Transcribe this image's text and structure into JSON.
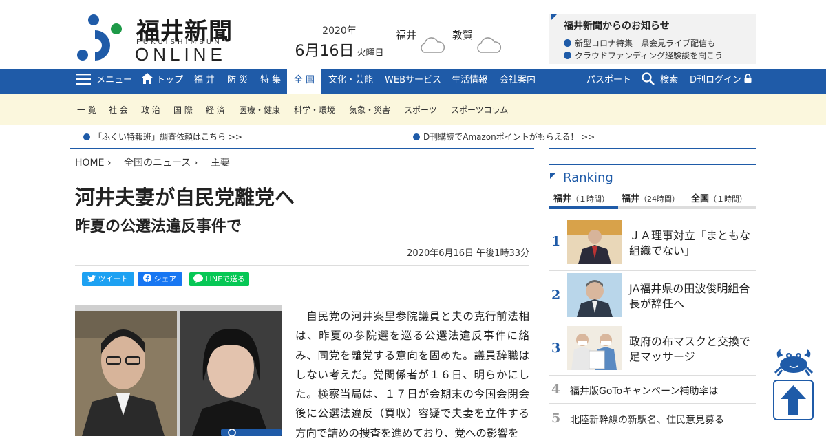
{
  "header": {
    "logo_title": "福井新聞",
    "logo_sub": "FUKUISHIMBUN",
    "logo_online": "ONLINE",
    "date": {
      "year": "2020年",
      "month_day": "6月16日",
      "weekday": "火曜日"
    },
    "weather": [
      {
        "city": "福井",
        "icon": "cloud-icon"
      },
      {
        "city": "敦賀",
        "icon": "cloud-icon"
      }
    ],
    "notice": {
      "title": "福井新聞からのお知らせ",
      "items": [
        "新型コロナ特集　県会見ライブ配信も",
        "クラウドファンディング経験談を聞こう"
      ]
    }
  },
  "nav": {
    "menu_label": "メニュー",
    "items": [
      "トップ",
      "福 井",
      "防 災",
      "特 集",
      "全 国",
      "文化・芸能",
      "WEBサービス",
      "生活情報",
      "会社案内"
    ],
    "active": "全 国",
    "passport": "パスポート",
    "search": "検索",
    "login": "D刊ログイン"
  },
  "subnav": [
    "一 覧",
    "社 会",
    "政 治",
    "国 際",
    "経 済",
    "医療・健康",
    "科学・環境",
    "気象・災害",
    "スポーツ",
    "スポーツコラム"
  ],
  "tickers": [
    "「ふくい特報班」調査依頼はこちら >>",
    "D刊購読でAmazonポイントがもらえる！ >>"
  ],
  "breadcrumb": [
    "HOME",
    "全国のニュース",
    "主要"
  ],
  "article": {
    "headline": "河井夫妻が自民党離党へ",
    "subhead": "昨夏の公選法違反事件で",
    "published": "2020年6月16日 午後1時33分",
    "share": {
      "tweet": "ツイート",
      "facebook": "シェア",
      "line": "LINEで送る"
    },
    "photo_caption": "拡大する",
    "body": "　自民党の河井案里参院議員と夫の克行前法相は、昨夏の参院選を巡る公選法違反事件に絡み、同党を離党する意向を固めた。議員辞職はしない考えだ。党関係者が１６日、明らかにした。検察当局は、１７日が会期末の今国会閉会後に公選法違反（買収）容疑で夫妻を立件する方向で詰めの捜査を進めており、党への影響を"
  },
  "ranking": {
    "title": "Ranking",
    "tabs": [
      {
        "name": "福井",
        "span": "（１時間）"
      },
      {
        "name": "福井",
        "span": "（24時間）"
      },
      {
        "name": "全国",
        "span": "（１時間）"
      }
    ],
    "items": [
      {
        "rank": "1",
        "title": "ＪＡ理事対立「まともな組織でない」"
      },
      {
        "rank": "2",
        "title": "JA福井県の田波俊明組合長が辞任へ"
      },
      {
        "rank": "3",
        "title": "政府の布マスクと交換で足マッサージ"
      },
      {
        "rank": "4",
        "title": "福井版GoToキャンペーン補助率は"
      },
      {
        "rank": "5",
        "title": "北陸新幹線の新駅名、住民意見募る"
      }
    ]
  },
  "colors": {
    "brand_blue": "#1f5ba8",
    "subnav_bg": "#fbf7dd",
    "twitter": "#1da1f2",
    "facebook": "#1877f2",
    "line": "#06c755"
  }
}
